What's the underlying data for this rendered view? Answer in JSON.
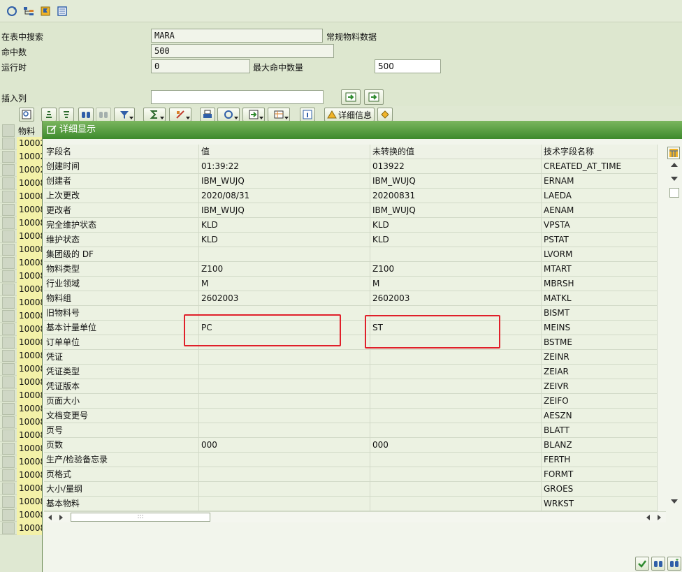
{
  "toolbar_top": {
    "icons": [
      "refresh-icon",
      "tree-icon",
      "flag-icon",
      "list-icon"
    ]
  },
  "search": {
    "search_table_label": "在表中搜索",
    "table_value": "MARA",
    "table_desc": "常规物料数据",
    "hits_label": "命中数",
    "hits_value": "500",
    "runtime_label": "运行时",
    "runtime_value": "0",
    "max_hits_label": "最大命中数量",
    "max_hits_value": "500",
    "insert_col_label": "插入列",
    "insert_col_value": ""
  },
  "alv_toolbar": {
    "detail_label": "详细信息"
  },
  "left_list": {
    "col_header": "物料",
    "values": [
      "10002",
      "10002",
      "10002",
      "10008",
      "10008",
      "10008",
      "10008",
      "10008",
      "10008",
      "10008",
      "10008",
      "10008",
      "10008",
      "10008",
      "10008",
      "10008",
      "10008",
      "10008",
      "10008",
      "10008",
      "10008",
      "10008",
      "10008",
      "10008",
      "10008",
      "10008",
      "10008",
      "10008",
      "10008",
      "10008"
    ]
  },
  "dialog": {
    "title": "详细显示",
    "columns": [
      "字段名",
      "值",
      "未转换的值",
      "技术字段名称"
    ],
    "rows": [
      [
        "创建时间",
        "01:39:22",
        "013922",
        "CREATED_AT_TIME"
      ],
      [
        "创建者",
        "IBM_WUJQ",
        "IBM_WUJQ",
        "ERNAM"
      ],
      [
        "上次更改",
        "2020/08/31",
        "20200831",
        "LAEDA"
      ],
      [
        "更改者",
        "IBM_WUJQ",
        "IBM_WUJQ",
        "AENAM"
      ],
      [
        "完全维护状态",
        "KLD",
        "KLD",
        "VPSTA"
      ],
      [
        "维护状态",
        "KLD",
        "KLD",
        "PSTAT"
      ],
      [
        "集团级的 DF",
        "",
        "",
        "LVORM"
      ],
      [
        "物料类型",
        "Z100",
        "Z100",
        "MTART"
      ],
      [
        "行业领域",
        "M",
        "M",
        "MBRSH"
      ],
      [
        "物料组",
        "2602003",
        "2602003",
        "MATKL"
      ],
      [
        "旧物料号",
        "",
        "",
        "BISMT"
      ],
      [
        "基本计量单位",
        "PC",
        "ST",
        "MEINS"
      ],
      [
        "订单单位",
        "",
        "",
        "BSTME"
      ],
      [
        "凭证",
        "",
        "",
        "ZEINR"
      ],
      [
        "凭证类型",
        "",
        "",
        "ZEIAR"
      ],
      [
        "凭证版本",
        "",
        "",
        "ZEIVR"
      ],
      [
        "页面大小",
        "",
        "",
        "ZEIFO"
      ],
      [
        "文档变更号",
        "",
        "",
        "AESZN"
      ],
      [
        "页号",
        "",
        "",
        "BLATT"
      ],
      [
        "页数",
        "000",
        "000",
        "BLANZ"
      ],
      [
        "生产/检验备忘录",
        "",
        "",
        "FERTH"
      ],
      [
        "页格式",
        "",
        "",
        "FORMT"
      ],
      [
        "大小/量纲",
        "",
        "",
        "GROES"
      ],
      [
        "基本物料",
        "",
        "",
        "WRKST"
      ]
    ],
    "hscroll_grip": ":::"
  },
  "colors": {
    "title_bar": "#4a9436",
    "highlight": "#e0202a",
    "material_cell": "#f3f1a8"
  }
}
